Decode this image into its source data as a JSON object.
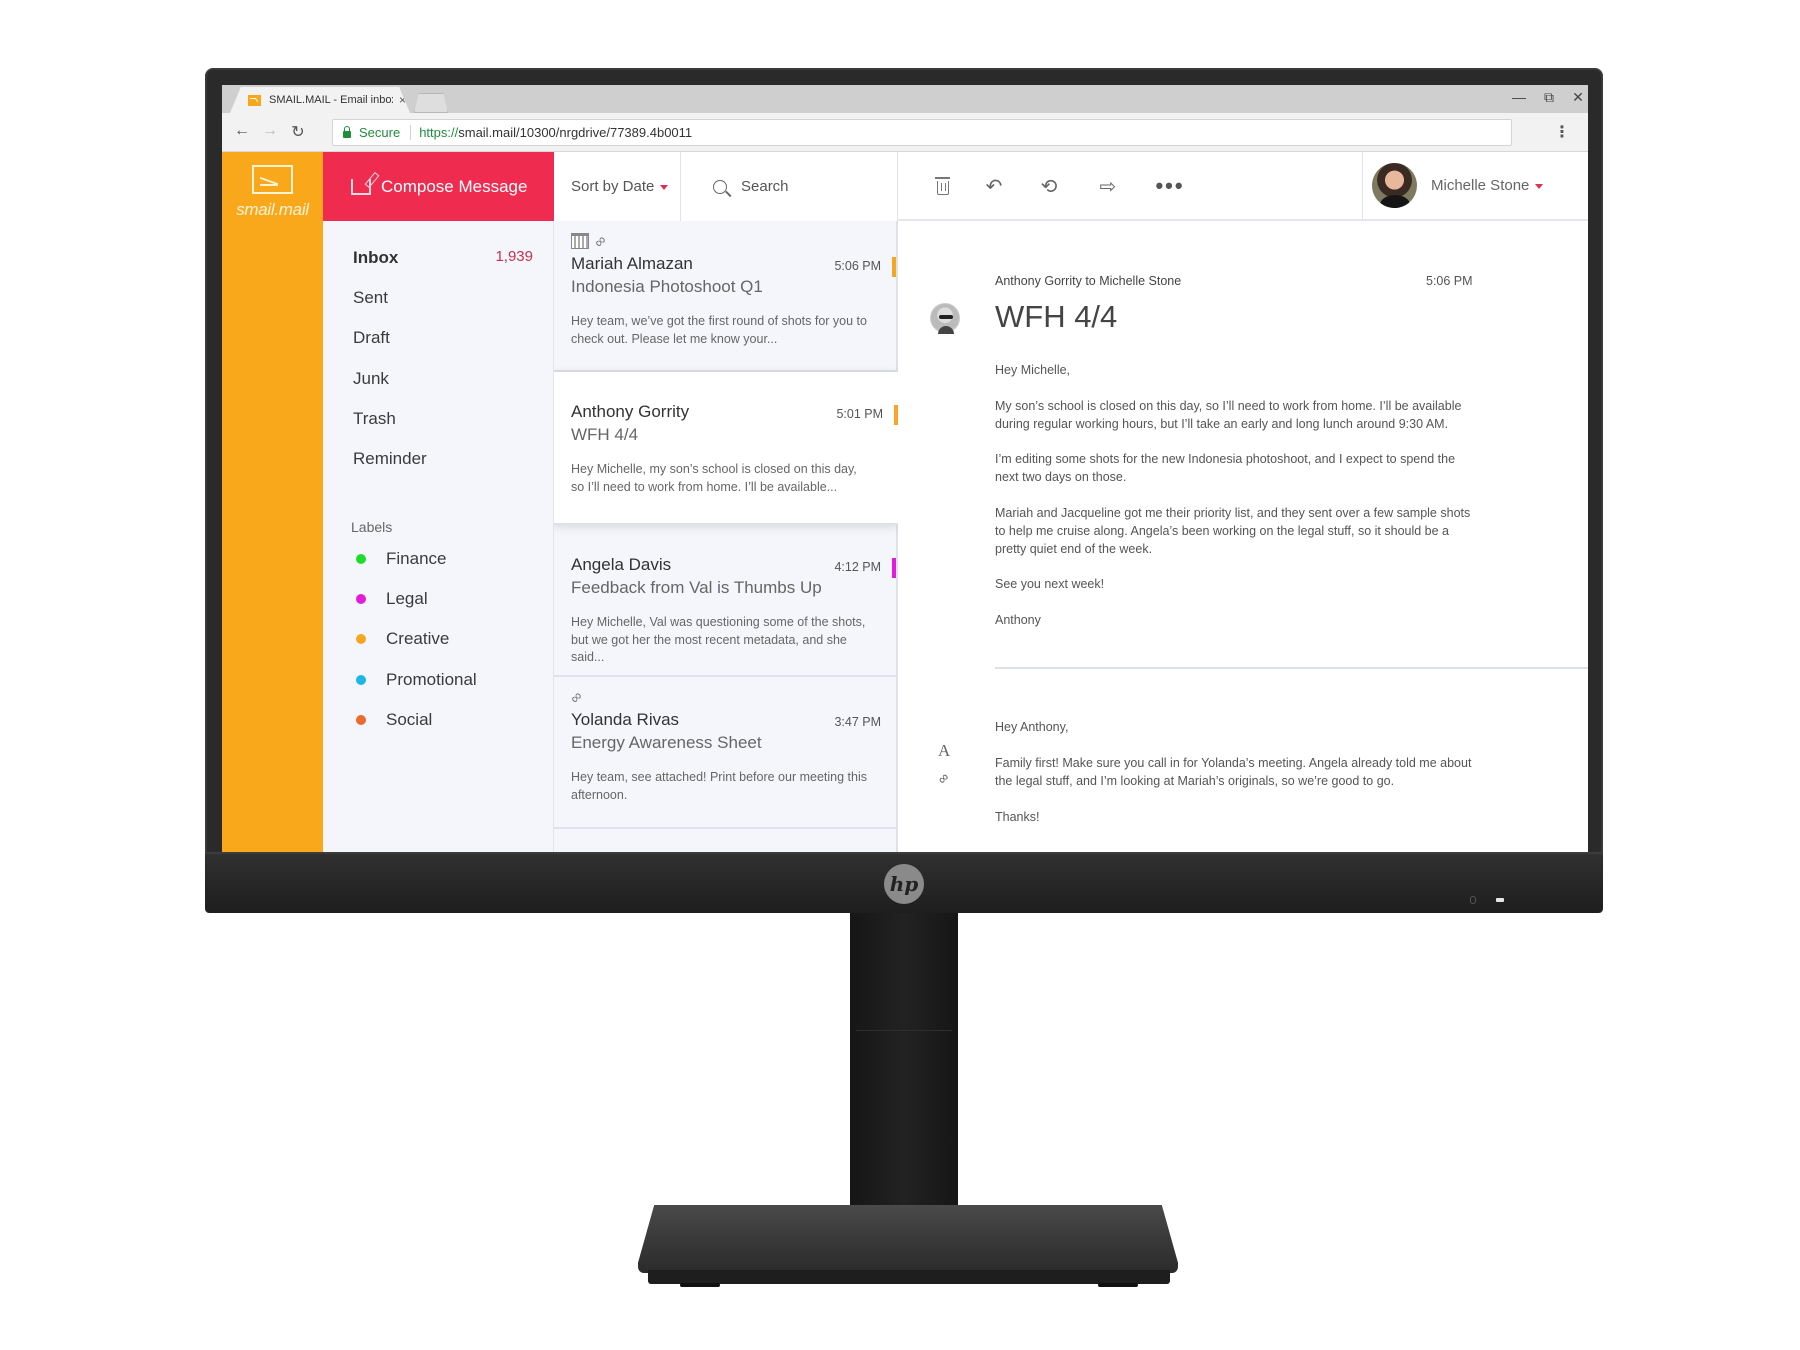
{
  "browser": {
    "tab_title": "SMAIL.MAIL - Email inbox",
    "tab_close": "×",
    "secure_label": "Secure",
    "url_scheme": "https://",
    "url_rest": "smail.mail/10300/nrgdrive/77389.4b0011",
    "back": "←",
    "forward": "→",
    "reload": "↻",
    "minimize": "—",
    "restore": "⧉",
    "close": "✕",
    "menu": "⋮"
  },
  "app": {
    "brand": "smail.mail",
    "accent_color": "#f9a81b",
    "compose_color": "#ef2b4f",
    "compose_label": "Compose Message",
    "sort_label": "Sort by Date",
    "search_label": "Search",
    "user_name": "Michelle Stone",
    "toolbar": {
      "reply": "↶",
      "reply_all": "⟲",
      "forward": "⇨",
      "more": "•••"
    }
  },
  "folders": [
    {
      "label": "Inbox",
      "count": "1,939",
      "active": true
    },
    {
      "label": "Sent"
    },
    {
      "label": "Draft"
    },
    {
      "label": "Junk"
    },
    {
      "label": "Trash"
    },
    {
      "label": "Reminder"
    }
  ],
  "labels_heading": "Labels",
  "labels": [
    {
      "label": "Finance",
      "color": "#1fdc2c"
    },
    {
      "label": "Legal",
      "color": "#e21cd8"
    },
    {
      "label": "Creative",
      "color": "#f5a623"
    },
    {
      "label": "Promotional",
      "color": "#1bb7ea"
    },
    {
      "label": "Social",
      "color": "#ec6a2b"
    }
  ],
  "messages": [
    {
      "from": "Mariah Almazan",
      "subject": "Indonesia Photoshoot Q1",
      "time": "5:06 PM",
      "flag": "#f5a623",
      "preview": "Hey team, we’ve got the first round of shots for you to check out. Please let me know your...",
      "icons": [
        "calendar",
        "attachment"
      ]
    },
    {
      "from": "Anthony Gorrity",
      "subject": "WFH 4/4",
      "time": "5:01 PM",
      "flag": "#f5a623",
      "preview": "Hey Michelle, my son’s school is closed on this day, so I’ll need to work from home. I’ll be available...",
      "selected": true
    },
    {
      "from": "Angela Davis",
      "subject": "Feedback from Val is Thumbs Up",
      "time": "4:12 PM",
      "flag": "#e21cd8",
      "preview": "Hey Michelle, Val was questioning some of the shots, but we got her the most recent metadata, and she said..."
    },
    {
      "from": "Yolanda Rivas",
      "subject": "Energy Awareness Sheet",
      "time": "3:47 PM",
      "preview": "Hey team, see attached! Print before our meeting this afternoon.",
      "icons": [
        "attachment"
      ]
    }
  ],
  "reader": {
    "meta": "Anthony Gorrity to Michelle Stone",
    "time": "5:06 PM",
    "subject": "WFH 4/4",
    "body": [
      "Hey Michelle,",
      "My son’s school is closed on this day, so I’ll need to work from home. I’ll be available during regular working hours, but I’ll take an early and long lunch around 9:30 AM.",
      "I’m editing some shots for the new Indonesia photoshoot, and I expect to spend the next two days on those.",
      "Mariah and Jacqueline got me their priority list, and they sent over a few sample shots to help me cruise along. Angela’s been working on the legal stuff, so it should be a pretty quiet end of the week.",
      "See you next week!",
      "Anthony"
    ],
    "reply": [
      "Hey Anthony,",
      "Family first! Make sure you call in for Yolanda’s meeting. Angela already told me about the legal stuff, and I’m looking at Mariah’s originals, so we’re good to go.",
      "Thanks!"
    ],
    "format_tool": "A",
    "attach_tool": "🔗"
  },
  "monitor": {
    "brand": "hp"
  }
}
